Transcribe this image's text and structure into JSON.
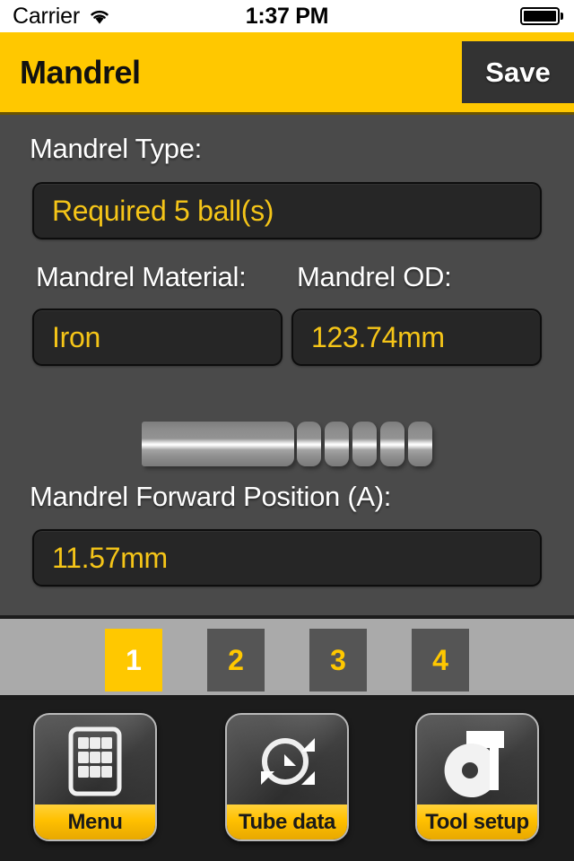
{
  "status_bar": {
    "carrier": "Carrier",
    "wifi_icon": "wifi-icon",
    "time": "1:37 PM",
    "battery_icon": "battery-full-icon",
    "battery_level_pct": 100
  },
  "nav_bar": {
    "title": "Mandrel",
    "save_label": "Save",
    "accent_color": "#ffc800",
    "button_color": "#333333"
  },
  "form": {
    "type": {
      "label": "Mandrel Type:",
      "value": "Required 5 ball(s)"
    },
    "material": {
      "label": "Mandrel Material:",
      "value": "Iron"
    },
    "od": {
      "label": "Mandrel OD:",
      "value": "123.74mm"
    },
    "forward_position": {
      "label": "Mandrel Forward Position (A):",
      "value": "11.57mm"
    },
    "value_color": "#f5c518",
    "label_color": "#ffffff",
    "field_bg": "#262626",
    "content_bg": "#4a4a4a"
  },
  "diagram": {
    "name": "mandrel-assembly-illustration",
    "shaft_count": 1,
    "ball_count": 5
  },
  "page_tabs": {
    "active_index": 0,
    "items": [
      {
        "label": "1",
        "active": true
      },
      {
        "label": "2",
        "active": false
      },
      {
        "label": "3",
        "active": false
      },
      {
        "label": "4",
        "active": false
      }
    ],
    "strip_bg": "#aaaaaa",
    "active_bg": "#ffc800",
    "inactive_bg": "#555555"
  },
  "toolbar": {
    "bg": "#1c1c1c",
    "items": [
      {
        "label": "Menu",
        "icon": "grid-menu-icon"
      },
      {
        "label": "Tube data",
        "icon": "tube-circle-arrows-icon"
      },
      {
        "label": "Tool setup",
        "icon": "bend-die-tooling-icon"
      }
    ]
  }
}
